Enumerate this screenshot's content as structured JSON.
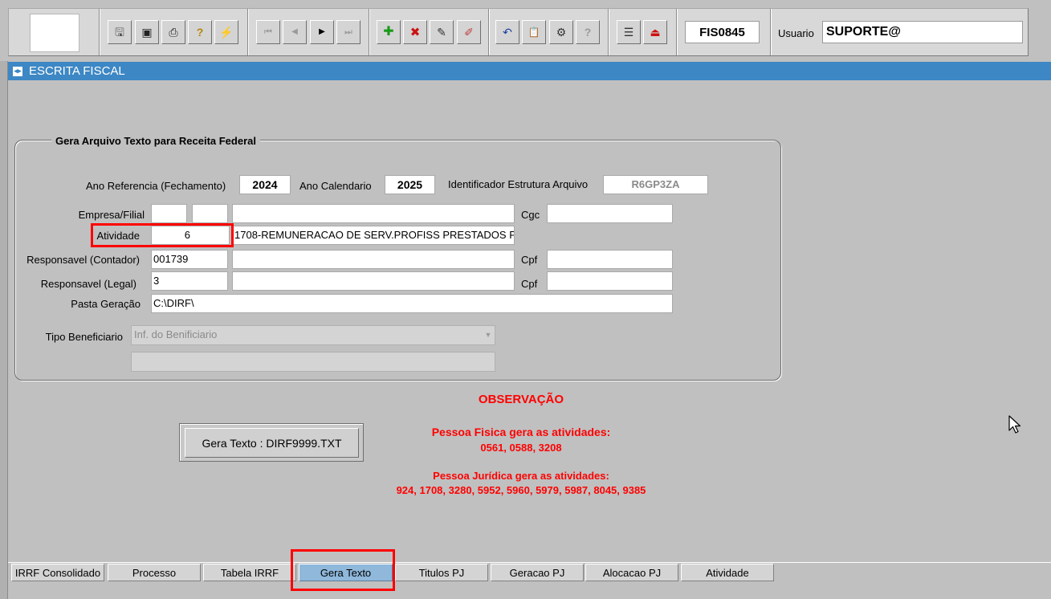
{
  "toolbar": {
    "form_code": "FIS0845",
    "user_label": "Usuario",
    "user_value": "SUPORTE@",
    "buttons": [
      {
        "name": "save-icon",
        "glyph": "🖫"
      },
      {
        "name": "window-icon",
        "glyph": "▣"
      },
      {
        "name": "print-icon",
        "glyph": "⎙"
      },
      {
        "name": "query-icon",
        "glyph": "?"
      },
      {
        "name": "execute-icon",
        "glyph": "⚡"
      },
      {
        "name": "first-record-icon",
        "glyph": "⏮"
      },
      {
        "name": "previous-record-icon",
        "glyph": "◀"
      },
      {
        "name": "next-record-icon",
        "glyph": "▶"
      },
      {
        "name": "last-record-icon",
        "glyph": "⏭"
      },
      {
        "name": "insert-record-icon",
        "glyph": "✚"
      },
      {
        "name": "delete-record-icon",
        "glyph": "✖"
      },
      {
        "name": "edit-record-icon",
        "glyph": "✎"
      },
      {
        "name": "clear-record-icon",
        "glyph": "✐"
      },
      {
        "name": "undo-icon",
        "glyph": "↶"
      },
      {
        "name": "clipboard-icon",
        "glyph": "📋"
      },
      {
        "name": "tools-icon",
        "glyph": "⚙"
      },
      {
        "name": "help-icon",
        "glyph": "?"
      },
      {
        "name": "menu-icon",
        "glyph": "☰"
      },
      {
        "name": "exit-icon",
        "glyph": "⏏"
      }
    ]
  },
  "window": {
    "title": "ESCRITA FISCAL"
  },
  "frame": {
    "title": "Gera Arquivo Texto para Receita Federal",
    "ano_ref_label": "Ano Referencia (Fechamento)",
    "ano_ref_value": "2024",
    "ano_cal_label": "Ano Calendario",
    "ano_cal_value": "2025",
    "ident_label": "Identificador Estrutura Arquivo",
    "ident_value": "R6GP3ZA",
    "empresa_label": "Empresa/Filial",
    "cgc_label": "Cgc",
    "atividade_label": "Atividade",
    "atividade_value": "6",
    "atividade_desc": "1708-REMUNERACAO DE SERV.PROFISS PRESTADOS P",
    "resp_contador_label": "Responsavel (Contador)",
    "resp_contador_value": "001739",
    "cpf_label": "Cpf",
    "resp_legal_label": "Responsavel (Legal)",
    "resp_legal_value": "3",
    "pasta_label": "Pasta Geração",
    "pasta_value": "C:\\DIRF\\",
    "tipo_benef_label": "Tipo Beneficiario",
    "tipo_benef_value": "Inf. do Benificiario"
  },
  "observacao": {
    "title": "OBSERVAÇÃO",
    "pf_title": "Pessoa Fisica gera as atividades:",
    "pf_list": "0561, 0588, 3208",
    "pj_title": "Pessoa Jurídica gera as atividades:",
    "pj_list": "924, 1708, 3280, 5952, 5960, 5979, 5987, 8045, 9385"
  },
  "gen_button": "Gera Texto : DIRF9999.TXT",
  "tabs": [
    {
      "label": "IRRF Consolidado",
      "active": false
    },
    {
      "label": "Processo",
      "active": false
    },
    {
      "label": "Tabela IRRF",
      "active": false
    },
    {
      "label": "Gera Texto",
      "active": true
    },
    {
      "label": "Titulos PJ",
      "active": false
    },
    {
      "label": "Geracao PJ",
      "active": false
    },
    {
      "label": "Alocacao PJ",
      "active": false
    },
    {
      "label": "Atividade",
      "active": false
    }
  ],
  "colors": {
    "titlebar": "#3d87c4",
    "active_tab": "#8fb8db",
    "highlight": "#ff0000",
    "observation_text": "#ff0000"
  }
}
